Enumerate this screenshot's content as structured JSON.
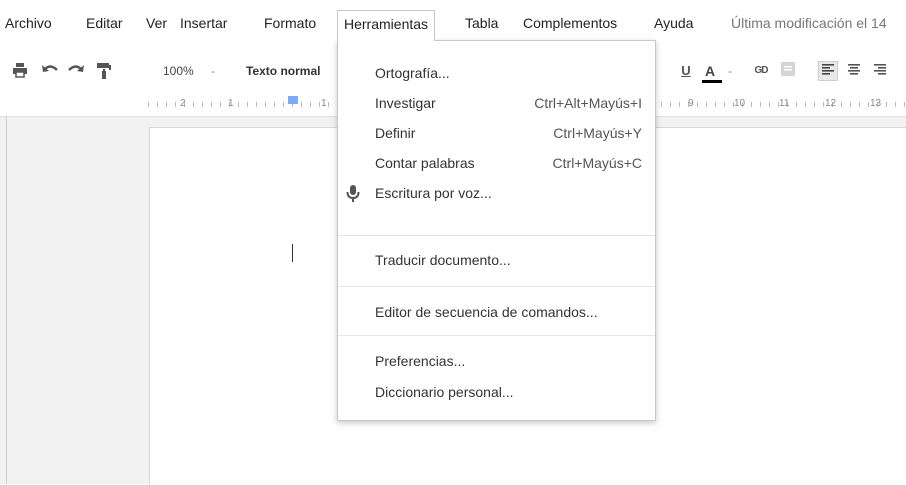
{
  "menubar": {
    "items": [
      "Archivo",
      "Editar",
      "Ver",
      "Insertar",
      "Formato",
      "Herramientas",
      "Tabla",
      "Complementos",
      "Ayuda"
    ],
    "last_modified": "Última modificación el 14"
  },
  "toolbar": {
    "zoom": "100%",
    "zoom_caret": "-",
    "style": "Texto normal",
    "icons": [
      "print-icon",
      "undo-icon",
      "redo-icon",
      "paint-format-icon",
      "underline-icon",
      "text-color-icon",
      "link-icon",
      "comment-icon",
      "align-left-icon",
      "align-center-icon",
      "align-right-icon"
    ],
    "underline_glyph": "U",
    "text_color_glyph": "A",
    "text_color_caret": "-",
    "link_glyph": "GD",
    "colors": {
      "text_color_bar": "#000000",
      "indent_marker": "#7baaf7"
    }
  },
  "ruler": {
    "labels": [
      "2",
      "1",
      "1",
      "9",
      "10",
      "11",
      "12",
      "13"
    ]
  },
  "dropdown": {
    "items": [
      {
        "label": "Ortografía...",
        "shortcut": ""
      },
      {
        "label": "Investigar",
        "shortcut": "Ctrl+Alt+Mayús+I"
      },
      {
        "label": "Definir",
        "shortcut": "Ctrl+Mayús+Y"
      },
      {
        "label": "Contar palabras",
        "shortcut": "Ctrl+Mayús+C"
      },
      {
        "label": "Escritura por voz...",
        "shortcut": "",
        "icon": "microphone-icon"
      },
      {
        "label": "Traducir documento...",
        "shortcut": ""
      },
      {
        "label": "Editor de secuencia de comandos...",
        "shortcut": ""
      },
      {
        "label": "Preferencias...",
        "shortcut": ""
      },
      {
        "label": "Diccionario personal...",
        "shortcut": ""
      }
    ]
  }
}
